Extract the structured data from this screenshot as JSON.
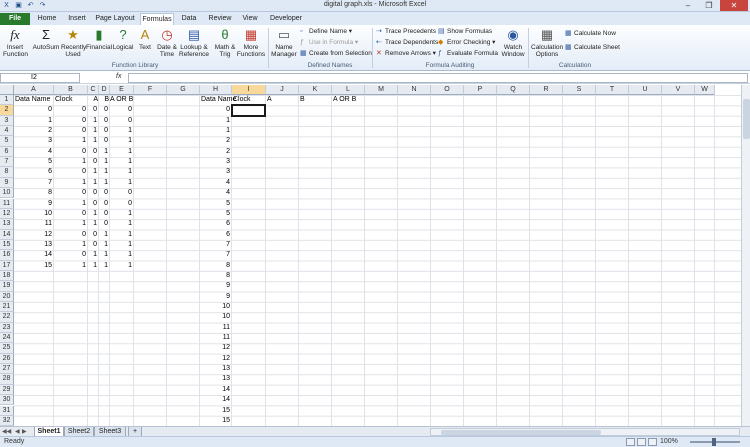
{
  "window": {
    "title": "digital graph.xls  -  Microsoft Excel",
    "controls": [
      "–",
      "❐",
      "✕"
    ]
  },
  "tabs": [
    "File",
    "Home",
    "Insert",
    "Page Layout",
    "Formulas",
    "Data",
    "Review",
    "View",
    "Developer"
  ],
  "ribbon": {
    "insert_function": "Insert Function",
    "autosum": "AutoSum",
    "recently_used": "Recently Used",
    "financial": "Financial",
    "logical": "Logical",
    "text": "Text",
    "date_time": "Date & Time",
    "lookup": "Lookup & Reference",
    "math": "Math & Trig",
    "more_functions": "More Functions",
    "function_library_label": "Function Library",
    "name_manager": "Name Manager",
    "define_name": "Define Name",
    "use_in_formula": "Use in Formula",
    "create_from_selection": "Create from Selection",
    "defined_names_label": "Defined Names",
    "trace_precedents": "Trace Precedents",
    "trace_dependents": "Trace Dependents",
    "remove_arrows": "Remove Arrows",
    "show_formulas": "Show Formulas",
    "error_checking": "Error Checking",
    "evaluate_formula": "Evaluate Formula",
    "watch_window": "Watch Window",
    "formula_auditing_label": "Formula Auditing",
    "calculation_options": "Calculation Options",
    "calculate_now": "Calculate Now",
    "calculate_sheet": "Calculate Sheet",
    "calculation_label": "Calculation"
  },
  "formula_bar": {
    "name_box": "I2",
    "fx": "fx",
    "content": ""
  },
  "columns": [
    "A",
    "B",
    "C",
    "D",
    "E",
    "F",
    "G",
    "H",
    "I",
    "J",
    "K",
    "L",
    "M",
    "N",
    "O",
    "P",
    "Q",
    "R",
    "S",
    "T",
    "U",
    "V",
    "W"
  ],
  "rows": [
    "1",
    "2",
    "3",
    "4",
    "5",
    "6",
    "7",
    "8",
    "9",
    "10",
    "11",
    "12",
    "13",
    "14",
    "15",
    "16",
    "17",
    "18",
    "19",
    "20",
    "21",
    "22",
    "23",
    "24",
    "25",
    "26",
    "27",
    "28",
    "29",
    "30",
    "31",
    "32"
  ],
  "headers_left": {
    "a": "Data Name",
    "b": "Clock",
    "c": "A",
    "d": "B",
    "e": "A OR B"
  },
  "headers_right": {
    "h": "Data Name",
    "i": "Clock",
    "j": "A",
    "k": "B",
    "l": "A OR B"
  },
  "table_left": [
    [
      "0",
      "0",
      "0",
      "0",
      "0"
    ],
    [
      "1",
      "0",
      "1",
      "0",
      "0"
    ],
    [
      "2",
      "0",
      "1",
      "0",
      "1"
    ],
    [
      "3",
      "1",
      "1",
      "0",
      "1"
    ],
    [
      "4",
      "0",
      "0",
      "1",
      "1"
    ],
    [
      "5",
      "1",
      "0",
      "1",
      "1"
    ],
    [
      "6",
      "0",
      "1",
      "1",
      "1"
    ],
    [
      "7",
      "1",
      "1",
      "1",
      "1"
    ],
    [
      "8",
      "0",
      "0",
      "0",
      "0"
    ],
    [
      "9",
      "1",
      "0",
      "0",
      "0"
    ],
    [
      "10",
      "0",
      "1",
      "0",
      "1"
    ],
    [
      "11",
      "1",
      "1",
      "0",
      "1"
    ],
    [
      "12",
      "0",
      "0",
      "1",
      "1"
    ],
    [
      "13",
      "1",
      "0",
      "1",
      "1"
    ],
    [
      "14",
      "0",
      "1",
      "1",
      "1"
    ],
    [
      "15",
      "1",
      "1",
      "1",
      "1"
    ]
  ],
  "column_h": [
    "0",
    "1",
    "1",
    "2",
    "2",
    "3",
    "3",
    "4",
    "4",
    "5",
    "5",
    "6",
    "6",
    "7",
    "7",
    "8",
    "8",
    "9",
    "9",
    "10",
    "10",
    "11",
    "11",
    "12",
    "12",
    "13",
    "13",
    "14",
    "14",
    "15",
    "15"
  ],
  "sheets": [
    "Sheet1",
    "Sheet2",
    "Sheet3"
  ],
  "status": {
    "ready": "Ready",
    "zoom": "100%"
  }
}
